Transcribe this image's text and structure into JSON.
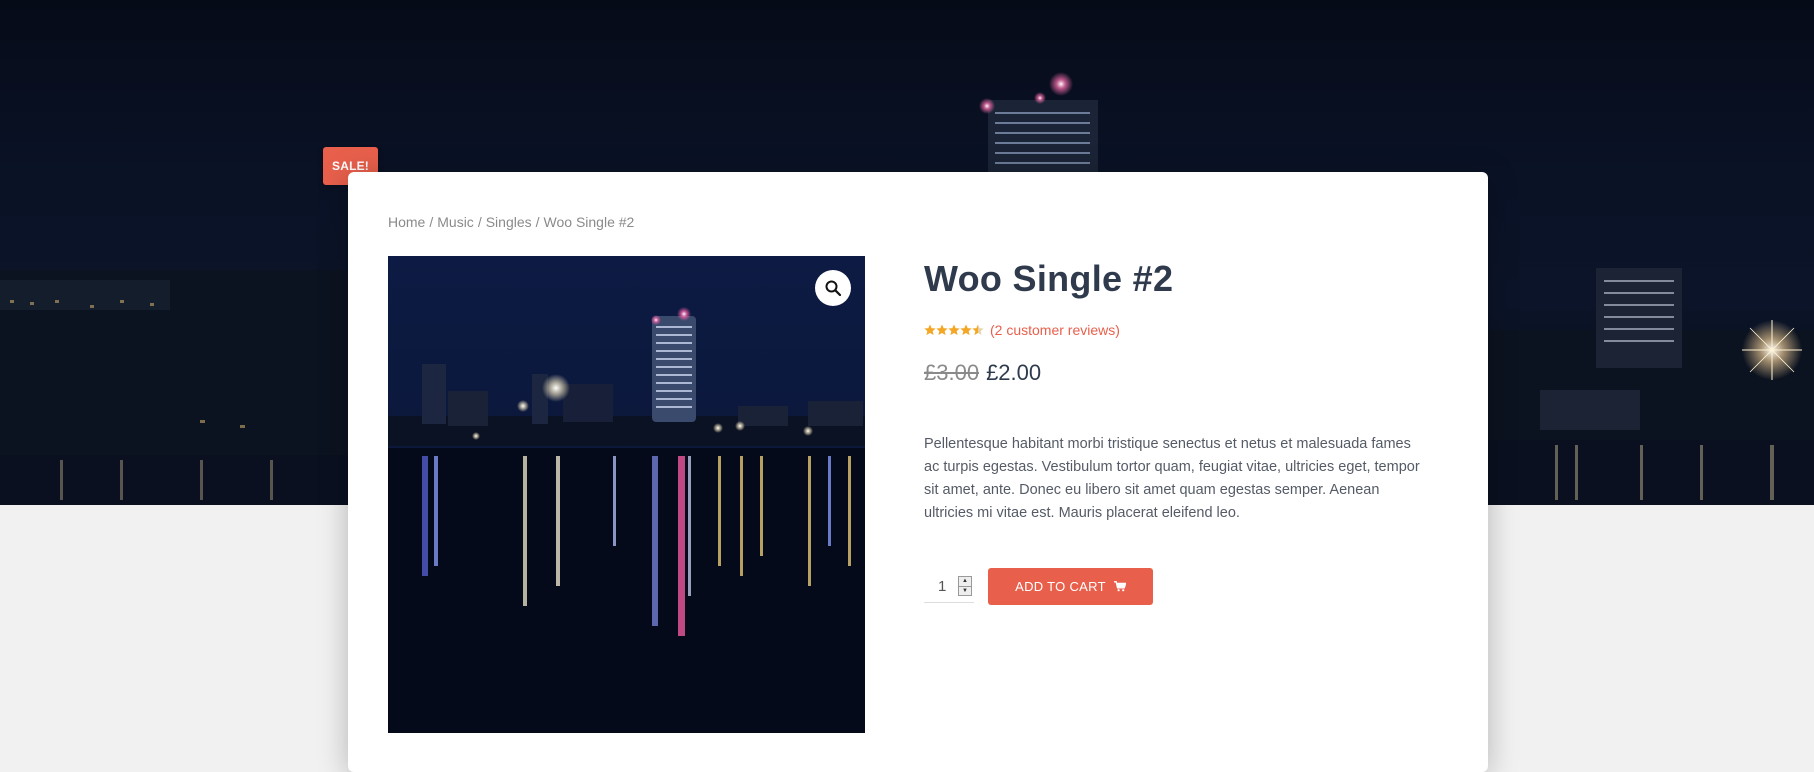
{
  "sale_badge": "SALE!",
  "breadcrumb": {
    "items": [
      "Home",
      "Music",
      "Singles"
    ],
    "current": "Woo Single #2",
    "separator": "/"
  },
  "product": {
    "title": "Woo Single #2",
    "rating": 4.5,
    "rating_max": 5,
    "reviews_link": "(2 customer reviews)",
    "old_price": "£3.00",
    "price": "£2.00",
    "description": "Pellentesque habitant morbi tristique senectus et netus et malesuada fames ac turpis egestas. Vestibulum tortor quam, feugiat vitae, ultricies eget, tempor sit amet, ante. Donec eu libero sit amet quam egestas semper. Aenean ultricies mi vitae est. Mauris placerat eleifend leo.",
    "quantity": "1"
  },
  "cart": {
    "add_to_cart_label": "ADD TO CART",
    "cart_icon": "cart-icon"
  },
  "icons": {
    "zoom": "search-icon",
    "star": "star-icon"
  },
  "colors": {
    "accent": "#e8604c",
    "title": "#2f3b4d",
    "star": "#f5a623",
    "hero_bg": "#0a1226"
  }
}
